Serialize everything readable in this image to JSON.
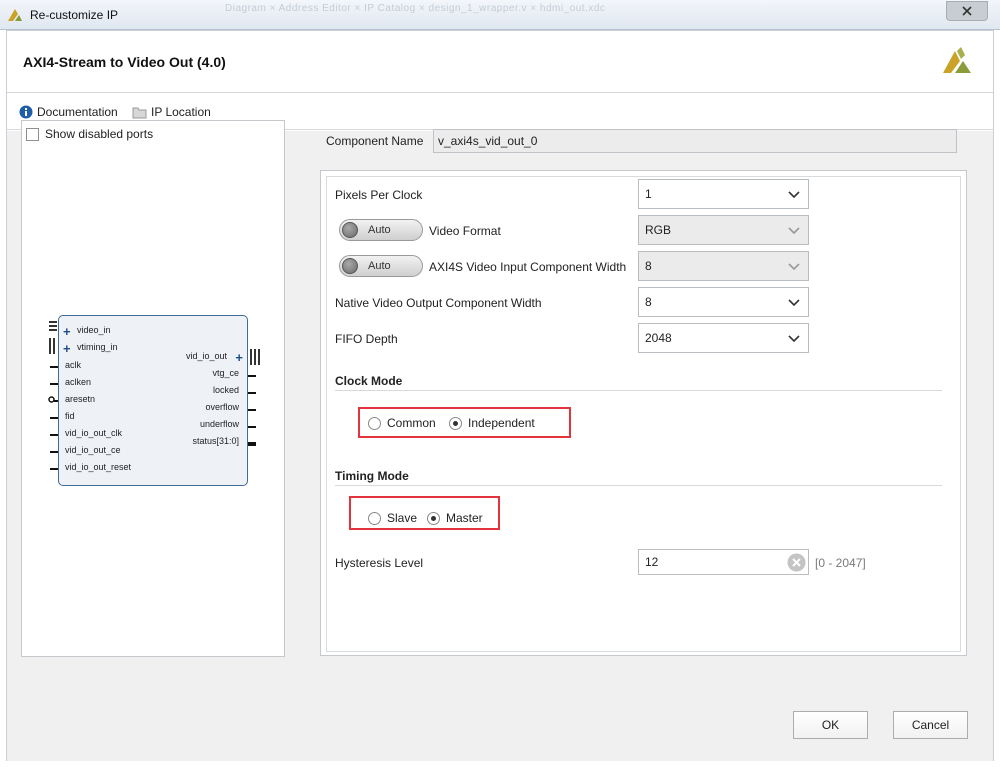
{
  "window": {
    "title": "Re-customize IP",
    "background_tabs": "Diagram  ×   Address Editor  ×   IP Catalog  ×   design_1_wrapper.v  ×   hdmi_out.xdc"
  },
  "header": {
    "ip_title": "AXI4-Stream to Video Out (4.0)"
  },
  "toolbar": {
    "documentation": "Documentation",
    "ip_location": "IP Location"
  },
  "left_panel": {
    "show_disabled_ports": "Show disabled ports",
    "block": {
      "left_bus_ports": [
        "video_in",
        "vtiming_in"
      ],
      "left_ports": [
        "aclk",
        "aclken",
        "aresetn",
        "fid",
        "vid_io_out_clk",
        "vid_io_out_ce",
        "vid_io_out_reset"
      ],
      "right_bus_ports": [
        "vid_io_out"
      ],
      "right_ports": [
        "vtg_ce",
        "locked",
        "overflow",
        "underflow",
        "status[31:0]"
      ]
    }
  },
  "component": {
    "label": "Component Name",
    "value": "v_axi4s_vid_out_0"
  },
  "params": {
    "pixels_per_clock": {
      "label": "Pixels Per Clock",
      "value": "1"
    },
    "video_format": {
      "toggle": "Auto",
      "label": "Video Format",
      "value": "RGB"
    },
    "input_width": {
      "toggle": "Auto",
      "label": "AXI4S Video Input Component Width",
      "value": "8"
    },
    "native_width": {
      "label": "Native Video Output Component Width",
      "value": "8"
    },
    "fifo_depth": {
      "label": "FIFO Depth",
      "value": "2048"
    },
    "clock_mode": {
      "title": "Clock Mode",
      "options": [
        "Common",
        "Independent"
      ],
      "selected": "Independent"
    },
    "timing_mode": {
      "title": "Timing Mode",
      "options": [
        "Slave",
        "Master"
      ],
      "selected": "Master"
    },
    "hysteresis": {
      "label": "Hysteresis Level",
      "value": "12",
      "range": "[0 - 2047]"
    }
  },
  "buttons": {
    "ok": "OK",
    "cancel": "Cancel"
  },
  "colors": {
    "highlight": "#e3343d",
    "block_border": "#3f6b97",
    "block_fill": "#eef2f7"
  }
}
